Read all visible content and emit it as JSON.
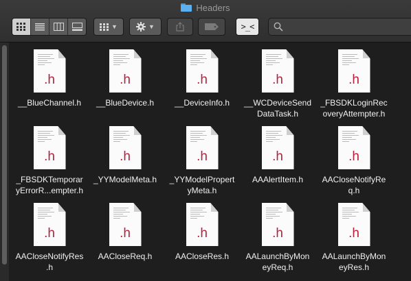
{
  "window": {
    "title": "Headers",
    "title_icon": "folder-icon"
  },
  "toolbar": {
    "view_modes": [
      {
        "name": "icon-view",
        "icon": "grid-icon",
        "active": true
      },
      {
        "name": "list-view",
        "icon": "list-icon",
        "active": false
      },
      {
        "name": "column-view",
        "icon": "columns-icon",
        "active": false
      },
      {
        "name": "gallery-view",
        "icon": "gallery-icon",
        "active": false
      }
    ],
    "group_button_icon": "grid-icon",
    "action_button_icon": "gear-icon",
    "share_button_icon": "share-icon",
    "tag_button_icon": "tag-icon",
    "terminal_button_icon": "terminal-icon",
    "terminal_glyph": ">_<",
    "search": {
      "placeholder": "",
      "value": ""
    }
  },
  "files": [
    {
      "ext": ".h",
      "label": "__BlueChannel.h"
    },
    {
      "ext": ".h",
      "label": "__BlueDevice.h"
    },
    {
      "ext": ".h",
      "label": "__DeviceInfo.h"
    },
    {
      "ext": ".h",
      "label": "__WCDeviceSend\nDataTask.h"
    },
    {
      "ext": ".h",
      "label": "_FBSDKLoginRec\noveryAttempter.h"
    },
    {
      "ext": ".h",
      "label": "_FBSDKTemporar\nyErrorR...empter.h"
    },
    {
      "ext": ".h",
      "label": "_YYModelMeta.h"
    },
    {
      "ext": ".h",
      "label": "_YYModelPropert\nyMeta.h"
    },
    {
      "ext": ".h",
      "label": "AAAlertItem.h"
    },
    {
      "ext": ".h",
      "label": "AACloseNotifyRe\nq.h"
    },
    {
      "ext": ".h",
      "label": "AACloseNotifyRes\n.h"
    },
    {
      "ext": ".h",
      "label": "AACloseReq.h"
    },
    {
      "ext": ".h",
      "label": "AACloseRes.h"
    },
    {
      "ext": ".h",
      "label": "AALaunchByMon\neyReq.h"
    },
    {
      "ext": ".h",
      "label": "AALaunchByMon\neyRes.h"
    }
  ]
}
